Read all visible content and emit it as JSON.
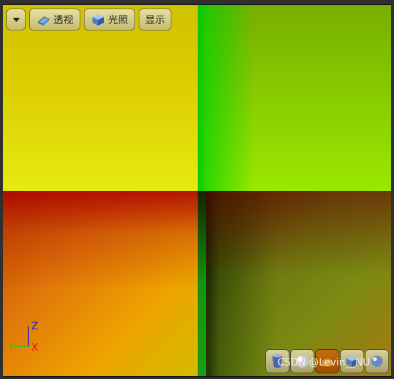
{
  "toolbar": {
    "menu_icon": "chevron-down-icon",
    "perspective_label": "透视",
    "perspective_icon": "eraser-icon",
    "lighting_label": "光照",
    "lighting_icon": "cube-icon",
    "show_label": "显示"
  },
  "axis": {
    "z": "Z",
    "x": "X",
    "y": "Y"
  },
  "view_buttons": [
    {
      "icon": "cylinder-icon",
      "active": false
    },
    {
      "icon": "sphere-icon",
      "active": false
    },
    {
      "icon": "shaded-icon",
      "active": true
    },
    {
      "icon": "box-icon",
      "active": false
    },
    {
      "icon": "material-icon",
      "active": false
    }
  ],
  "watermark": "CSDN @Levin__NU",
  "colors": {
    "accent": "#b8620a",
    "button_bg": "#d6cf90"
  }
}
